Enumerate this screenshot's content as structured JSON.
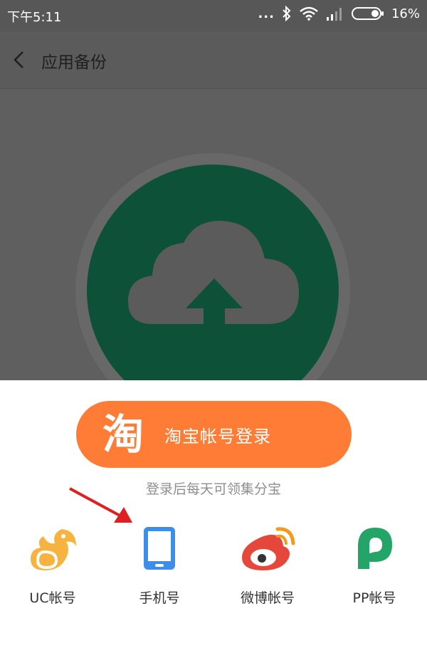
{
  "status_bar": {
    "time": "下午5:11",
    "dots": "...",
    "battery": "16%"
  },
  "app_bar": {
    "back_icon": "chevron-left-icon",
    "title": "应用备份"
  },
  "hero": {
    "icon": "cloud-upload-icon",
    "circle_color": "#0e5139"
  },
  "login_sheet": {
    "taobao_button": {
      "logo_glyph": "淘",
      "label": "淘宝帐号登录",
      "color": "#ff7c36"
    },
    "hint": "登录后每天可领集分宝",
    "options": [
      {
        "label": "UC帐号",
        "icon": "uc-squirrel-icon",
        "color": "#f7b340"
      },
      {
        "label": "手机号",
        "icon": "phone-icon",
        "color": "#3d8ee6"
      },
      {
        "label": "微博帐号",
        "icon": "weibo-icon",
        "color": "#e6473b"
      },
      {
        "label": "PP帐号",
        "icon": "pp-icon",
        "color": "#22a566"
      }
    ]
  }
}
